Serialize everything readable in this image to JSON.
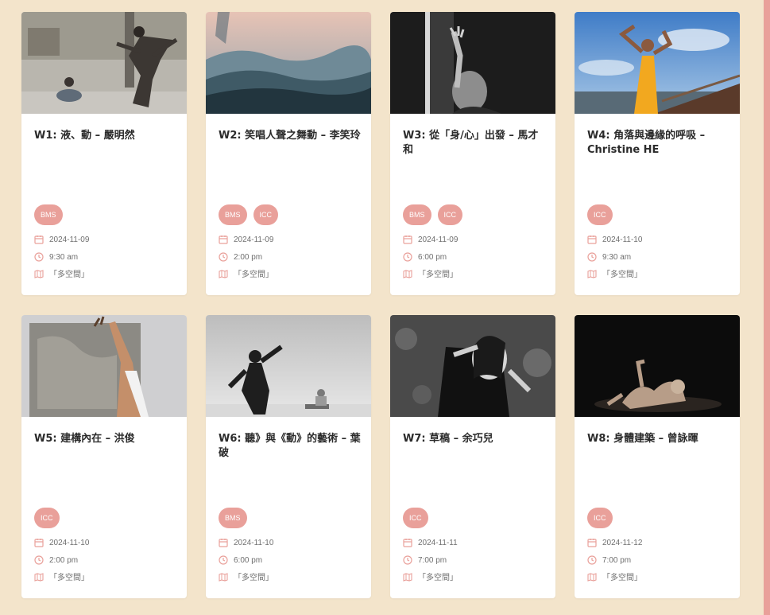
{
  "colors": {
    "background": "#f3e4cb",
    "accent": "#e9a09a",
    "card": "#ffffff"
  },
  "cards": [
    {
      "title": "W1: 液、動 – 嚴明然",
      "tags": [
        "BMS"
      ],
      "date": "2024-11-09",
      "time": "9:30 am",
      "place": "「多空間」"
    },
    {
      "title": "W2: 笑唱人聲之舞動 – 李笑玲",
      "tags": [
        "BMS",
        "ICC"
      ],
      "date": "2024-11-09",
      "time": "2:00 pm",
      "place": "「多空間」"
    },
    {
      "title": "W3: 從「身/心」出發 – 馬才和",
      "tags": [
        "BMS",
        "ICC"
      ],
      "date": "2024-11-09",
      "time": "6:00 pm",
      "place": "「多空間」"
    },
    {
      "title": "W4: 角落與邊緣的呼吸 – Christine HE",
      "tags": [
        "ICC"
      ],
      "date": "2024-11-10",
      "time": "9:30 am",
      "place": "「多空間」"
    },
    {
      "title": "W5: 建構內在 – 洪俊",
      "tags": [
        "ICC"
      ],
      "date": "2024-11-10",
      "time": "2:00 pm",
      "place": "「多空間」"
    },
    {
      "title": "W6: 聽》與《動》的藝術 – 葉破",
      "tags": [
        "BMS"
      ],
      "date": "2024-11-10",
      "time": "6:00 pm",
      "place": "「多空間」"
    },
    {
      "title": "W7: 草稿 – 余巧兒",
      "tags": [
        "ICC"
      ],
      "date": "2024-11-11",
      "time": "7:00 pm",
      "place": "「多空間」"
    },
    {
      "title": "W8: 身體建築 – 曾詠暉",
      "tags": [
        "ICC"
      ],
      "date": "2024-11-12",
      "time": "7:00 pm",
      "place": "「多空間」"
    }
  ],
  "icons": {
    "date": "calendar-icon",
    "time": "clock-icon",
    "place": "map-icon"
  }
}
